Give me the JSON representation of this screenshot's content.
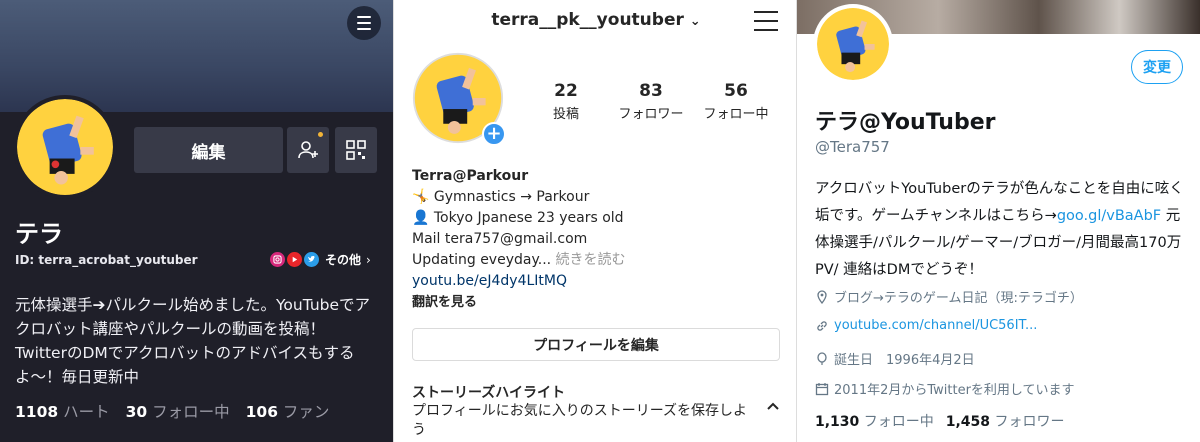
{
  "tiktok": {
    "edit_label": "編集",
    "name": "テラ",
    "id_text": "ID: terra_acrobat_youtuber",
    "more_label": "その他",
    "bio": [
      "元体操選手➔パルクール始めました。YouTubeでア",
      "クロバット講座やパルクールの動画を投稿！",
      "TwitterのDMでアクロバットのアドバイスもする",
      "よ〜！毎日更新中"
    ],
    "stats": {
      "likes": "1108",
      "likes_label": "ハート",
      "following": "30",
      "following_label": "フォロー中",
      "fans": "106",
      "fans_label": "ファン"
    }
  },
  "instagram": {
    "username": "terra__pk__youtuber",
    "stats": [
      {
        "value": "22",
        "label": "投稿"
      },
      {
        "value": "83",
        "label": "フォロワー"
      },
      {
        "value": "56",
        "label": "フォロー中"
      }
    ],
    "display_name": "Terra@Parkour",
    "bio_lines": [
      "🤸 Gymnastics → Parkour",
      "👤 Tokyo Jpanese 23 years old",
      "Mail tera757@gmail.com"
    ],
    "bio_truncated": "Updating eveyday...",
    "more_label": "続きを読む",
    "link": "youtu.be/eJ4dy4LItMQ",
    "translate_label": "翻訳を見る",
    "edit_profile_label": "プロフィールを編集",
    "highlights_title": "ストーリーズハイライト",
    "highlights_desc": "プロフィールにお気に入りのストーリーズを保存しよう"
  },
  "twitter": {
    "change_label": "変更",
    "name": "テラ@YouTuber",
    "handle": "@Tera757",
    "bio_part1": "アクロバットYouTuberのテラが色んなことを自由に呟く垢です。ゲームチャンネルはこちら→",
    "bio_link": "goo.gl/vBaAbF",
    "bio_part2": " 元体操選手/パルクール/ゲーマー/ブロガー/月間最高170万PV/ 連絡はDMでどうぞ！",
    "location": "ブログ→テラのゲーム日記（現:テラゴチ）",
    "website": "youtube.com/channel/UC56IT...",
    "birthday_label": "誕生日",
    "birthday": "1996年4月2日",
    "joined": "2011年2月からTwitterを利用しています",
    "following_count": "1,130",
    "following_label": "フォロー中",
    "followers_count": "1,458",
    "followers_label": "フォロワー"
  },
  "colors": {
    "tiktok_bg": "#1f1f29",
    "instagram_blue": "#3897f0",
    "twitter_blue": "#1da1f2"
  }
}
